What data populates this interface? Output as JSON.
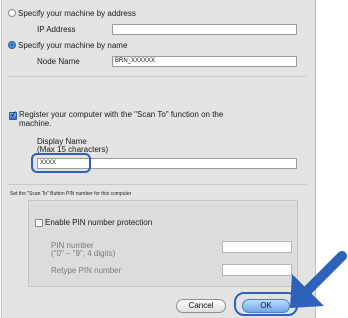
{
  "radio_address": {
    "label": "Specify your machine by address"
  },
  "ip_address": {
    "label": "IP Address",
    "value": ""
  },
  "radio_name": {
    "label": "Specify your machine by name"
  },
  "node_name": {
    "label": "Node Name",
    "value": "BRN_XXXXXX"
  },
  "register": {
    "label_line1": "Register your computer with the \"Scan To\" function on the",
    "label_line2": "machine."
  },
  "display_name": {
    "label": "Display Name",
    "hint": "(Max 15 characters)",
    "value": "XXXX"
  },
  "pin_section": {
    "title": "Set the \"Scan To\" Button PIN number for this computer",
    "enable_label": "Enable PIN number protection",
    "pin_label": "PIN number",
    "pin_hint": "(\"0\" – \"9\", 4 digits)",
    "retype_label": "Retype PIN number",
    "pin_value": "",
    "retype_value": ""
  },
  "buttons": {
    "cancel": "Cancel",
    "ok": "OK"
  },
  "colors": {
    "highlight": "#2d62b8",
    "arrow": "#2d62b8"
  }
}
